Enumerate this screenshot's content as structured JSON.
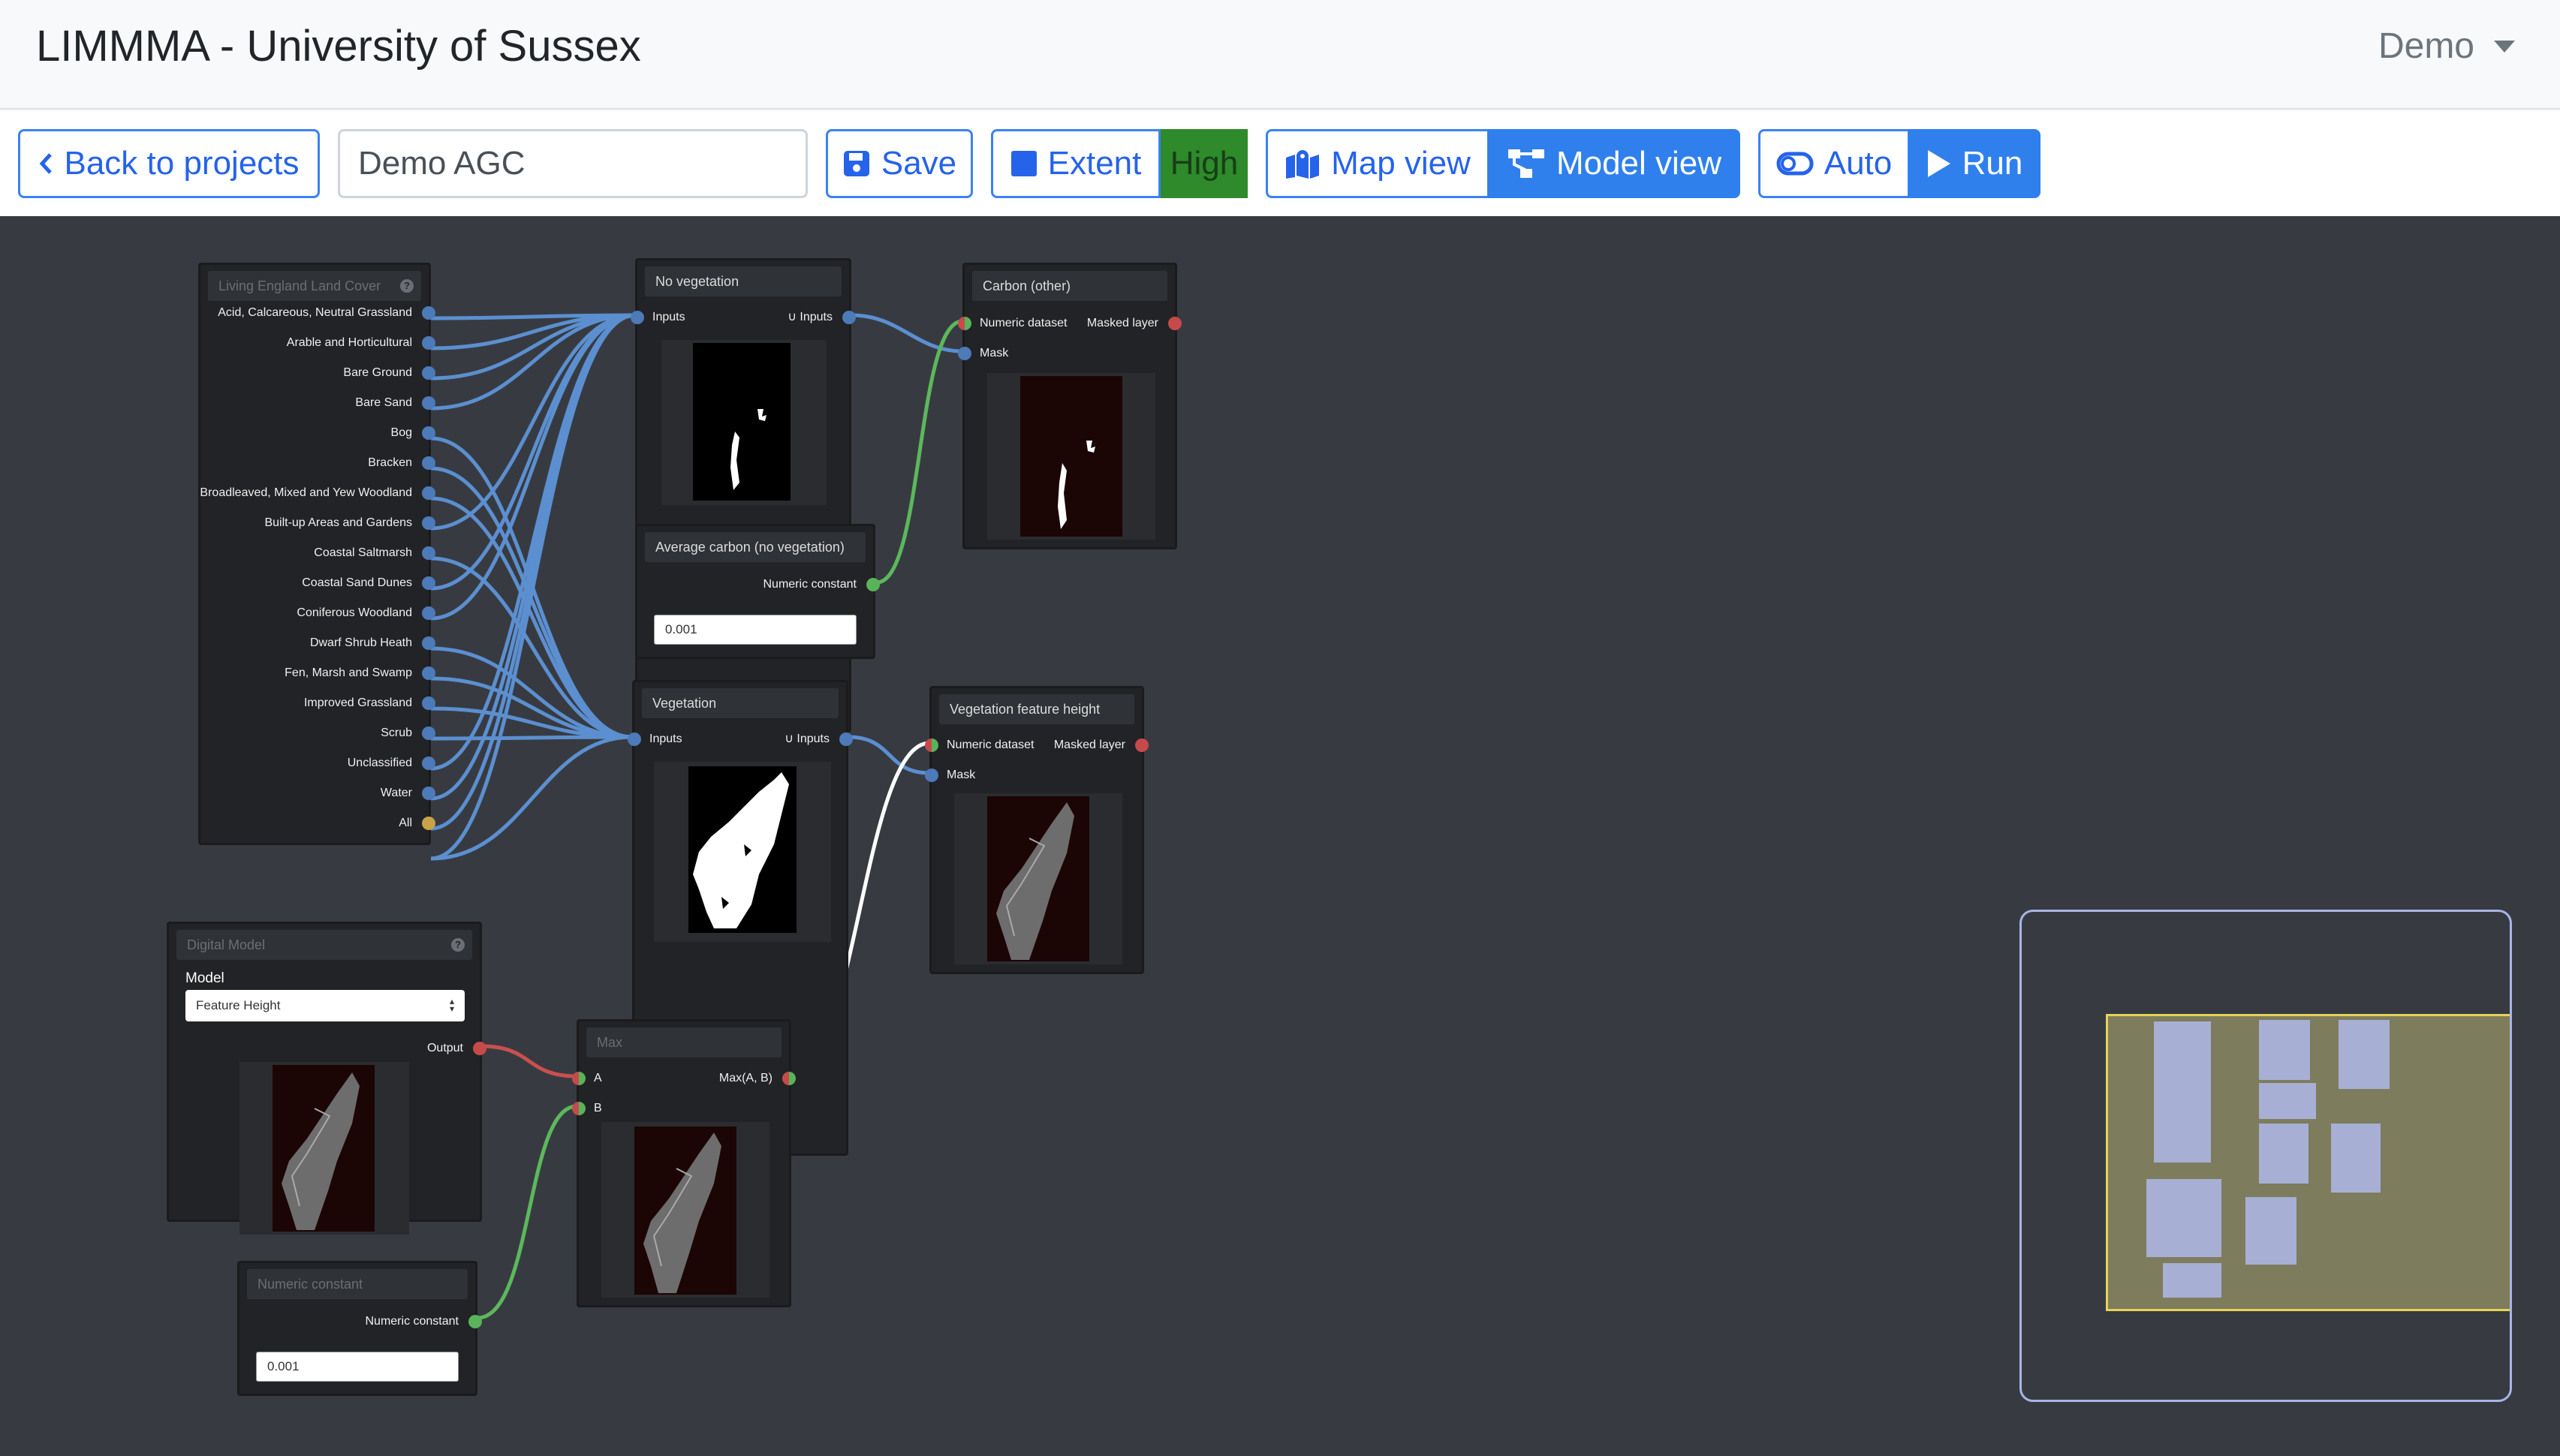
{
  "header": {
    "title": "LIMMMA - University of Sussex",
    "user_menu": "Demo"
  },
  "toolbar": {
    "back_label": "Back to projects",
    "project_name": "Demo AGC",
    "save_label": "Save",
    "extent_label": "Extent",
    "resolution_badge": "High",
    "map_view_label": "Map view",
    "model_view_label": "Model view",
    "auto_label": "Auto",
    "run_label": "Run",
    "active_view": "Model view"
  },
  "nodes": {
    "land_cover": {
      "title": "Living England Land Cover",
      "outputs": [
        "Acid, Calcareous, Neutral Grassland",
        "Arable and Horticultural",
        "Bare Ground",
        "Bare Sand",
        "Bog",
        "Bracken",
        "Broadleaved, Mixed and Yew Woodland",
        "Built-up Areas and Gardens",
        "Coastal Saltmarsh",
        "Coastal Sand Dunes",
        "Coniferous Woodland",
        "Dwarf Shrub Heath",
        "Fen, Marsh and Swamp",
        "Improved Grassland",
        "Scrub",
        "Unclassified",
        "Water",
        "All"
      ]
    },
    "no_vegetation": {
      "title": "No vegetation",
      "input": "Inputs",
      "output": "∪ Inputs"
    },
    "avg_carbon": {
      "title": "Average carbon (no vegetation)",
      "output": "Numeric constant",
      "value": "0.001"
    },
    "vegetation": {
      "title": "Vegetation",
      "input": "Inputs",
      "output": "∪ Inputs"
    },
    "carbon_other": {
      "title": "Carbon (other)",
      "input_dataset": "Numeric dataset",
      "input_mask": "Mask",
      "output": "Masked layer"
    },
    "veg_feature_height": {
      "title": "Vegetation feature height",
      "input_dataset": "Numeric dataset",
      "input_mask": "Mask",
      "output": "Masked layer"
    },
    "digital_model": {
      "title": "Digital Model",
      "model_label": "Model",
      "model_value": "Feature Height",
      "output": "Output"
    },
    "max": {
      "title": "Max",
      "input_a": "A",
      "input_b": "B",
      "output": "Max(A, B)"
    },
    "numeric_constant": {
      "title": "Numeric constant",
      "output": "Numeric constant",
      "value": "0.001"
    }
  },
  "colors": {
    "accent": "#2f80ed",
    "canvas": "#373b41",
    "wire_blue": "#5b8fd0",
    "wire_green": "#5cb85c",
    "wire_red": "#c9504f",
    "wire_white": "#ffffff",
    "badge_high": "#2e8a2a"
  }
}
